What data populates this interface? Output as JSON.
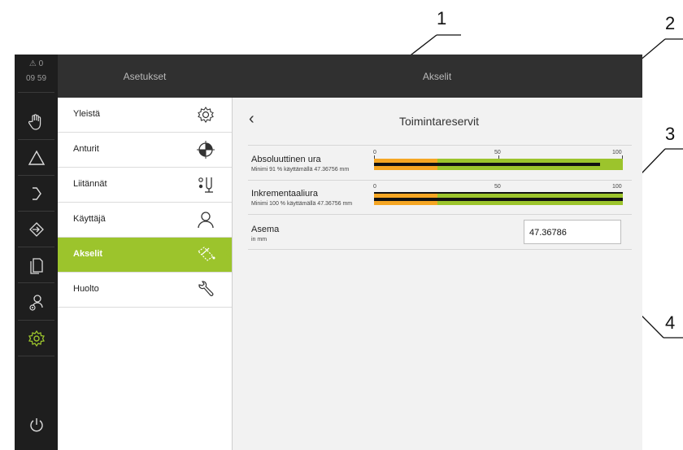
{
  "callouts": [
    "1",
    "2",
    "3",
    "4"
  ],
  "status": {
    "warnings": "⚠ 0",
    "time": "09 59"
  },
  "rail": [
    {
      "name": "manual-mode-icon"
    },
    {
      "name": "delta-icon"
    },
    {
      "name": "arrow-right-icon"
    },
    {
      "name": "signin-icon"
    },
    {
      "name": "file-icon"
    },
    {
      "name": "user-settings-icon"
    },
    {
      "name": "settings-gear-icon"
    },
    {
      "name": "power-icon"
    }
  ],
  "menu": {
    "title": "Asetukset",
    "items": [
      {
        "label": "Yleistä",
        "icon": "gear-icon"
      },
      {
        "label": "Anturit",
        "icon": "sensor-icon"
      },
      {
        "label": "Liitännät",
        "icon": "connections-icon"
      },
      {
        "label": "Käyttäjä",
        "icon": "user-icon"
      },
      {
        "label": "Akselit",
        "icon": "axes-icon",
        "active": true
      },
      {
        "label": "Huolto",
        "icon": "wrench-icon"
      }
    ]
  },
  "content": {
    "header": "Akselit",
    "back": "‹",
    "title": "Toimintareservit",
    "rows": [
      {
        "title": "Absoluuttinen ura",
        "sub": "Minimi 91 % käyttämällä 47.36756 mm",
        "fill": 0.91
      },
      {
        "title": "Inkrementaaliura",
        "sub": "Minimi 100 % käyttämällä 47.36756 mm",
        "fill": 1.0
      }
    ],
    "scale": [
      "0",
      "50",
      "100"
    ],
    "position": {
      "label": "Asema",
      "unit": "in mm",
      "value": "47.36786"
    }
  },
  "colors": {
    "accent": "#9cc42c",
    "warning": "#f5a623",
    "dark": "#1e1e1e"
  }
}
